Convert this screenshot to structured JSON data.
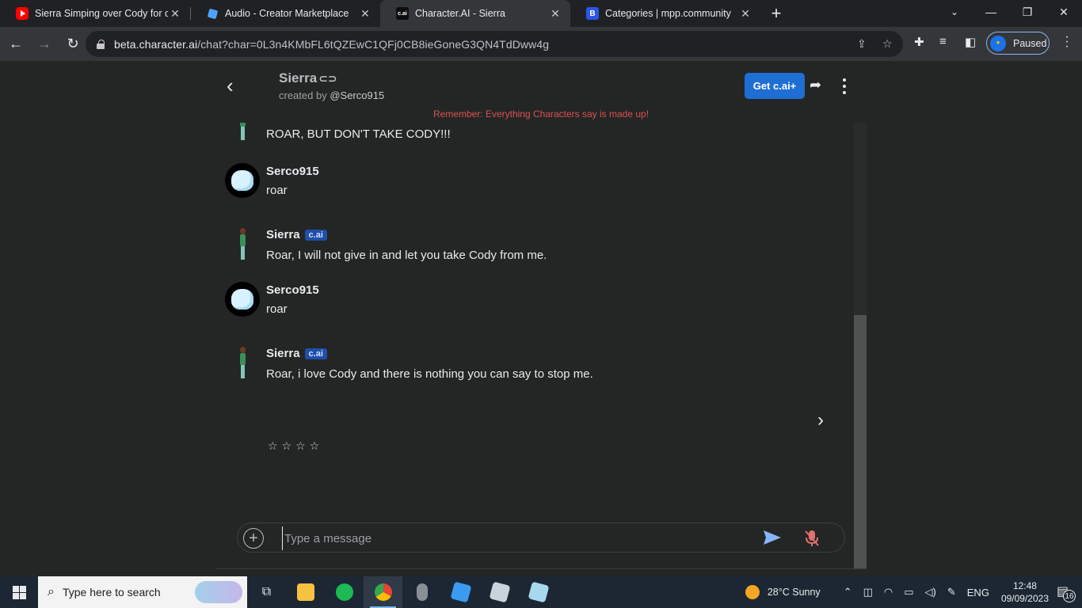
{
  "browser": {
    "tabs": [
      {
        "title": "Sierra Simping over Cody for ove",
        "favicon": "youtube-icon",
        "active": false
      },
      {
        "title": "Audio - Creator Marketplace",
        "favicon": "roblox-icon",
        "active": false
      },
      {
        "title": "Character.AI - Sierra",
        "favicon": "character-ai-icon",
        "active": true
      },
      {
        "title": "Categories | mpp.community",
        "favicon": "mpp-community-icon",
        "active": false
      }
    ],
    "url_domain": "beta.character.ai",
    "url_path": "/chat?char=0L3n4KMbFL6tQZEwC1QFj0CB8ieGoneG3QN4TdDww4g",
    "profile_label": "Paused"
  },
  "header": {
    "character_name": "Sierra",
    "created_by_prefix": "created by",
    "creator_handle": "@Serco915",
    "get_plus_label": "Get c.ai+",
    "reminder": "Remember: Everything Characters say is made up!"
  },
  "messages": [
    {
      "author": "",
      "badge": "",
      "text": "ROAR, BUT DON'T TAKE CODY!!!",
      "avatar": "sierra"
    },
    {
      "author": "Serco915",
      "badge": "",
      "text": "roar",
      "avatar": "cat"
    },
    {
      "author": "Sierra",
      "badge": "c.ai",
      "text": "Roar, I will not give in and let you take Cody from me.",
      "avatar": "sierra"
    },
    {
      "author": "Serco915",
      "badge": "",
      "text": "roar",
      "avatar": "cat"
    },
    {
      "author": "Sierra",
      "badge": "c.ai",
      "text": "Roar, i love Cody and there is nothing you can say to stop me.",
      "avatar": "sierra"
    }
  ],
  "rating_stars": "☆☆☆☆",
  "composer": {
    "placeholder": "Type a message"
  },
  "taskbar": {
    "search_placeholder": "Type here to search",
    "weather": "28°C  Sunny",
    "language": "ENG",
    "time": "12:48",
    "date": "09/09/2023",
    "notification_count": "16"
  },
  "colors": {
    "accent": "#1f6ed4",
    "reminder": "#d9534f",
    "badge": "#1f4fa8"
  }
}
